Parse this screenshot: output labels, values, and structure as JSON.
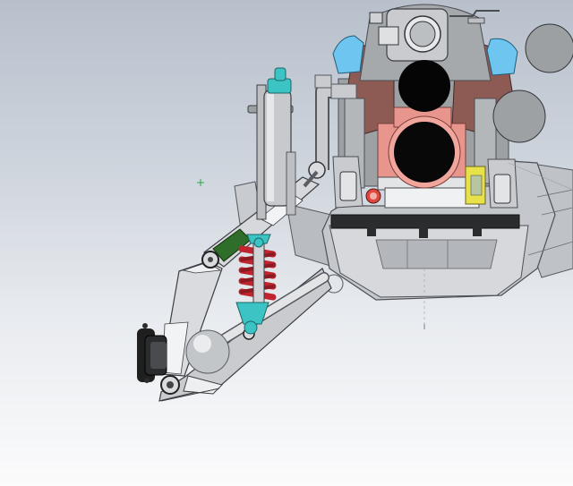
{
  "viewport": {
    "background_top": "#b8c0cc",
    "background_bottom": "#fbfbfc"
  },
  "model": {
    "colors": {
      "steel": "#d4d6d9",
      "steel_light": "#eeeff0",
      "steel_dark": "#8d9197",
      "engine_gray": "#9ea1a4",
      "cylinder_head": "#8e5a54",
      "salmon": "#e8958d",
      "teal": "#3cc4c4",
      "cyan": "#6ec6f0",
      "spring_red": "#c0242e",
      "rubber": "#1f1f1f",
      "green": "#2f6e2a",
      "yellow": "#e8e24a"
    }
  }
}
